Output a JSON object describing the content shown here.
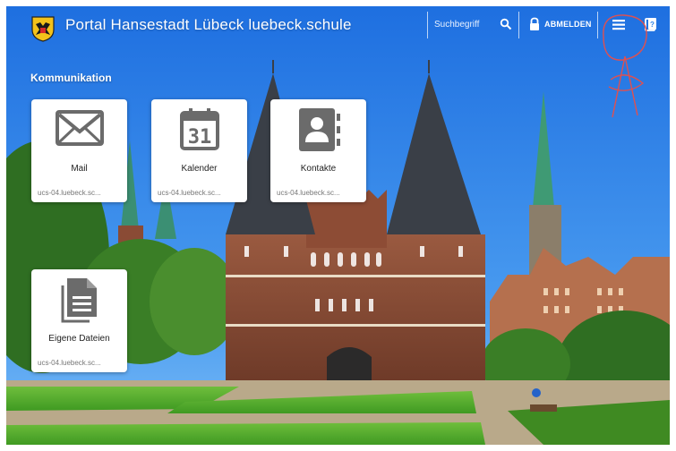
{
  "header": {
    "title": "Portal Hansestadt Lübeck luebeck.schule",
    "search_placeholder": "Suchbegriff",
    "logout_label": "ABMELDEN",
    "icons": [
      "crest-icon",
      "search-icon",
      "lock-icon",
      "menu-icon",
      "help-icon"
    ]
  },
  "main": {
    "section_title": "Kommunikation",
    "tiles": [
      {
        "label": "Mail",
        "host": "ucs-04.luebeck.sc...",
        "icon": "mail-icon"
      },
      {
        "label": "Kalender",
        "host": "ucs-04.luebeck.sc...",
        "icon": "calendar-icon"
      },
      {
        "label": "Kontakte",
        "host": "ucs-04.luebeck.sc...",
        "icon": "contacts-icon"
      },
      {
        "label": "Eigene Dateien",
        "host": "ucs-04.luebeck.sc...",
        "icon": "file-icon"
      }
    ]
  },
  "colors": {
    "sky": "#2f84e8",
    "tile_bg": "#ffffff",
    "icon_gray": "#6b6b6b",
    "brick": "#8a4b35"
  }
}
